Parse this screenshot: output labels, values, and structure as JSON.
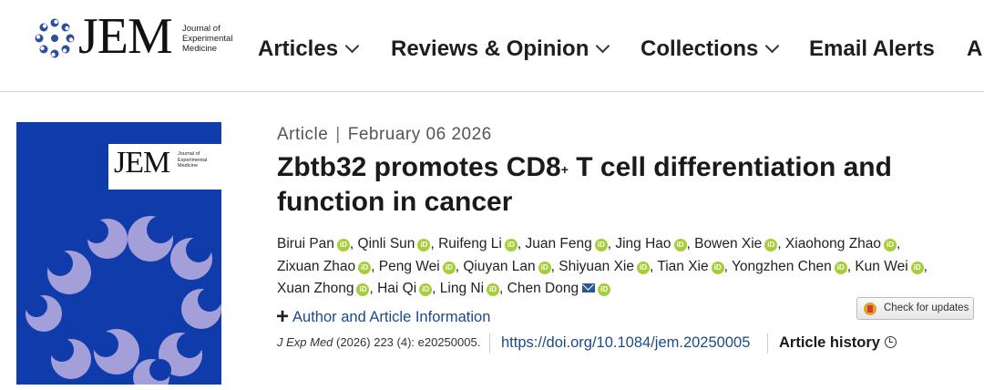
{
  "logo": {
    "jem": "JEM",
    "sub_lines": [
      "Journal of",
      "Experimental",
      "Medicine"
    ]
  },
  "nav": [
    {
      "label": "Articles",
      "dropdown": true
    },
    {
      "label": "Reviews & Opinion",
      "dropdown": true
    },
    {
      "label": "Collections",
      "dropdown": true
    },
    {
      "label": "Email Alerts",
      "dropdown": false
    },
    {
      "label": "A",
      "dropdown": false
    }
  ],
  "cover": {
    "jem": "JEM",
    "sub_lines": [
      "Journal of",
      "Experimental",
      "Medicine"
    ],
    "bg_color": "#0f3caa",
    "shape_color": "#a49fd8"
  },
  "article": {
    "type": "Article",
    "separator": "|",
    "date": "February 06 2026",
    "title_part1": "Zbtb32 promotes CD8",
    "title_sup": "+",
    "title_part2": " T cell differentiation and function in cancer",
    "authors": [
      {
        "name": "Birui Pan",
        "orcid": true
      },
      {
        "name": "Qinli Sun",
        "orcid": true
      },
      {
        "name": "Ruifeng Li",
        "orcid": true
      },
      {
        "name": "Juan Feng",
        "orcid": true
      },
      {
        "name": "Jing Hao",
        "orcid": true
      },
      {
        "name": "Bowen Xie",
        "orcid": true
      },
      {
        "name": "Xiaohong Zhao",
        "orcid": true
      },
      {
        "name": "Zixuan Zhao",
        "orcid": true
      },
      {
        "name": "Peng Wei",
        "orcid": true
      },
      {
        "name": "Qiuyan Lan",
        "orcid": true
      },
      {
        "name": "Shiyuan Xie",
        "orcid": true
      },
      {
        "name": "Tian Xie",
        "orcid": true
      },
      {
        "name": "Yongzhen Chen",
        "orcid": true
      },
      {
        "name": "Kun Wei",
        "orcid": true
      },
      {
        "name": "Xuan Zhong",
        "orcid": true
      },
      {
        "name": "Hai Qi",
        "orcid": true
      },
      {
        "name": "Ling Ni",
        "orcid": true
      },
      {
        "name": "Chen Dong",
        "orcid": true,
        "email": true
      }
    ],
    "author_info_label": "Author and Article Information",
    "check_updates_label": "Check for updates",
    "citation_journal": "J Exp Med",
    "citation_rest": " (2026) 223 (4): e20250005.",
    "doi": "https://doi.org/10.1084/jem.20250005",
    "history_label": "Article history"
  },
  "icons": {
    "orcid_text": "iD"
  },
  "colors": {
    "link": "#1a4a8a",
    "orcid_green": "#a6ce39",
    "logo_blue": "#2a4fa0"
  }
}
